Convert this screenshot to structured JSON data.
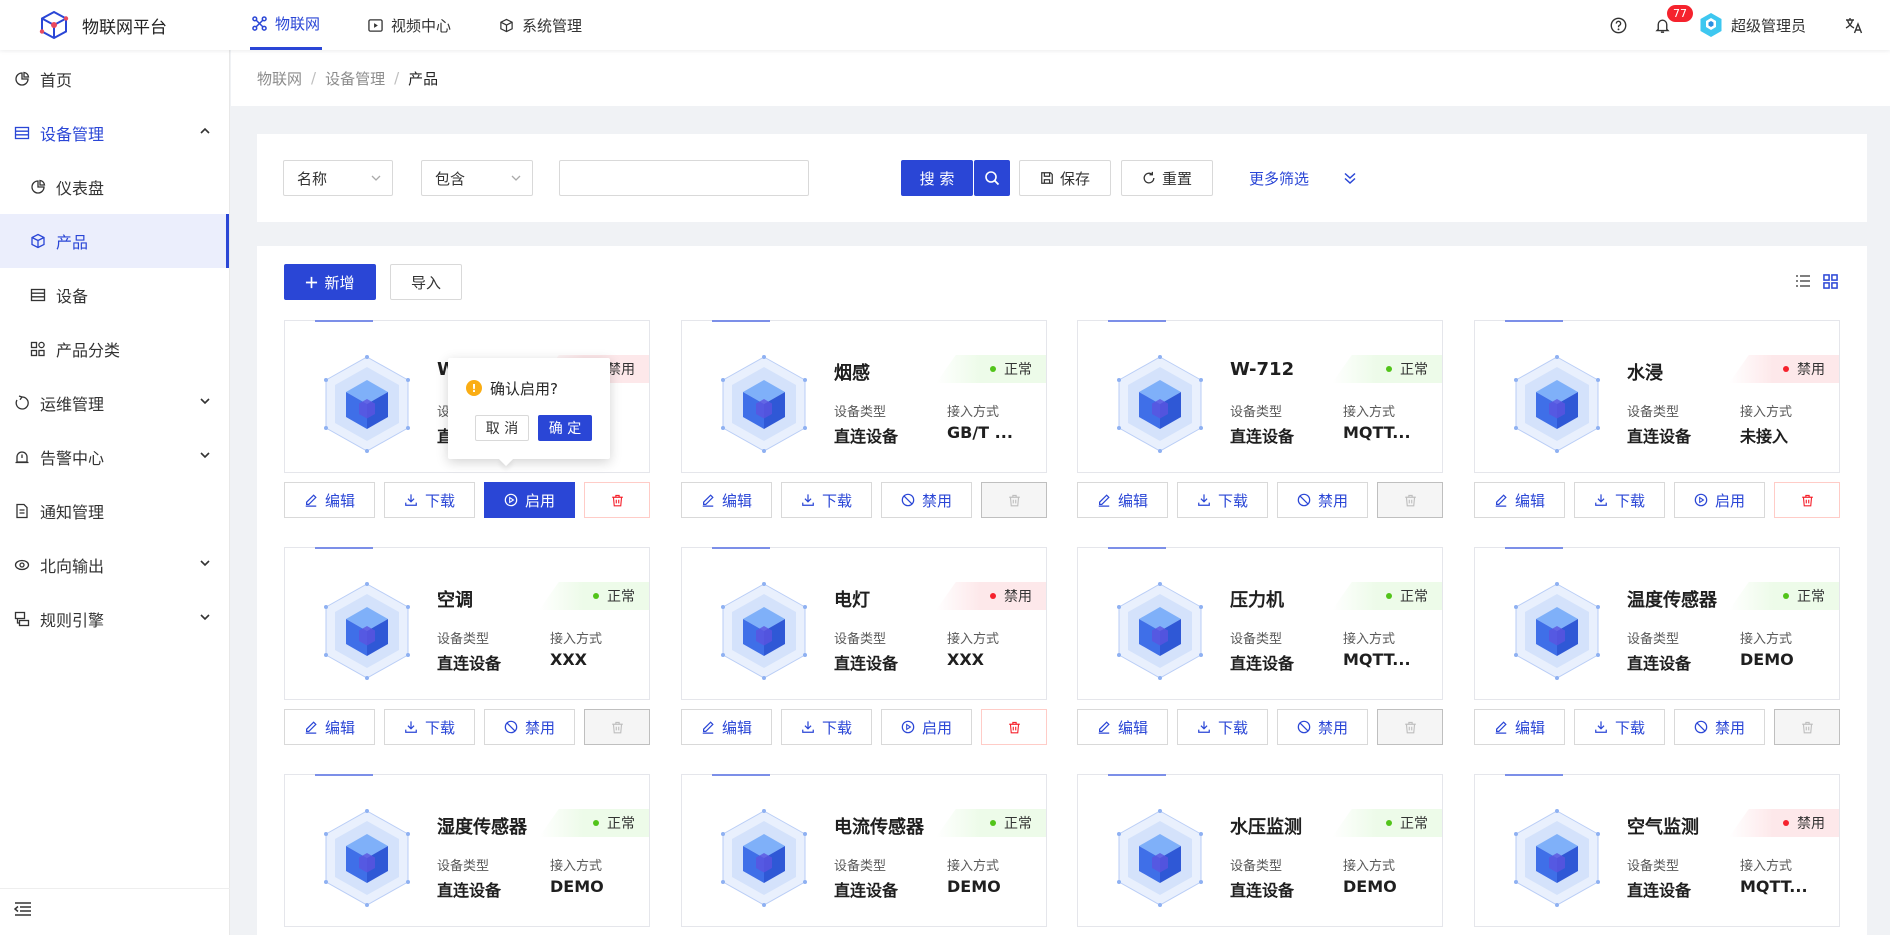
{
  "app": {
    "title": "物联网平台"
  },
  "topnav": [
    {
      "label": "物联网",
      "icon": "iot-icon",
      "active": true
    },
    {
      "label": "视频中心",
      "icon": "play-icon",
      "active": false
    },
    {
      "label": "系统管理",
      "icon": "cube-icon",
      "active": false
    }
  ],
  "header": {
    "notification_count": "77",
    "user_name": "超级管理员"
  },
  "sidebar": {
    "home": "首页",
    "device_mgmt": "设备管理",
    "dashboard": "仪表盘",
    "product": "产品",
    "device": "设备",
    "product_category": "产品分类",
    "ops": "运维管理",
    "alarm": "告警中心",
    "notice": "通知管理",
    "north": "北向输出",
    "rules": "规则引擎"
  },
  "breadcrumb": [
    "物联网",
    "设备管理",
    "产品"
  ],
  "filter": {
    "field_select": "名称",
    "operator_select": "包含",
    "keyword_value": "",
    "search_label": "搜 索",
    "save_label": "保存",
    "reset_label": "重置",
    "more_filter_label": "更多筛选"
  },
  "toolbar": {
    "add_label": "新增",
    "import_label": "导入"
  },
  "labels": {
    "device_type": "设备类型",
    "access_mode": "接入方式",
    "edit": "编辑",
    "download": "下载",
    "enable": "启用",
    "disable": "禁用"
  },
  "popconfirm": {
    "title": "确认启用?",
    "cancel": "取 消",
    "ok": "确 定"
  },
  "cards": [
    {
      "name": "W",
      "status": "禁用",
      "status_kind": "off",
      "device_type": "直连设备",
      "access": "",
      "toggle": "enable",
      "popconfirm": true
    },
    {
      "name": "烟感",
      "status": "正常",
      "status_kind": "ok",
      "device_type": "直连设备",
      "access": "GB/T ...",
      "toggle": "disable"
    },
    {
      "name": "W-712",
      "status": "正常",
      "status_kind": "ok",
      "device_type": "直连设备",
      "access": "MQTT...",
      "toggle": "disable"
    },
    {
      "name": "水浸",
      "status": "禁用",
      "status_kind": "off",
      "device_type": "直连设备",
      "access": "未接入",
      "toggle": "enable"
    },
    {
      "name": "空调",
      "status": "正常",
      "status_kind": "ok",
      "device_type": "直连设备",
      "access": "XXX",
      "toggle": "disable"
    },
    {
      "name": "电灯",
      "status": "禁用",
      "status_kind": "off",
      "device_type": "直连设备",
      "access": "XXX",
      "toggle": "enable"
    },
    {
      "name": "压力机",
      "status": "正常",
      "status_kind": "ok",
      "device_type": "直连设备",
      "access": "MQTT...",
      "toggle": "disable"
    },
    {
      "name": "温度传感器",
      "status": "正常",
      "status_kind": "ok",
      "device_type": "直连设备",
      "access": "DEMO",
      "toggle": "disable"
    },
    {
      "name": "湿度传感器",
      "status": "正常",
      "status_kind": "ok",
      "device_type": "直连设备",
      "access": "DEMO",
      "toggle": "none"
    },
    {
      "name": "电流传感器",
      "status": "正常",
      "status_kind": "ok",
      "device_type": "直连设备",
      "access": "DEMO",
      "toggle": "none"
    },
    {
      "name": "水压监测",
      "status": "正常",
      "status_kind": "ok",
      "device_type": "直连设备",
      "access": "DEMO",
      "toggle": "none"
    },
    {
      "name": "空气监测",
      "status": "禁用",
      "status_kind": "off",
      "device_type": "直连设备",
      "access": "MQTT...",
      "toggle": "none"
    }
  ]
}
